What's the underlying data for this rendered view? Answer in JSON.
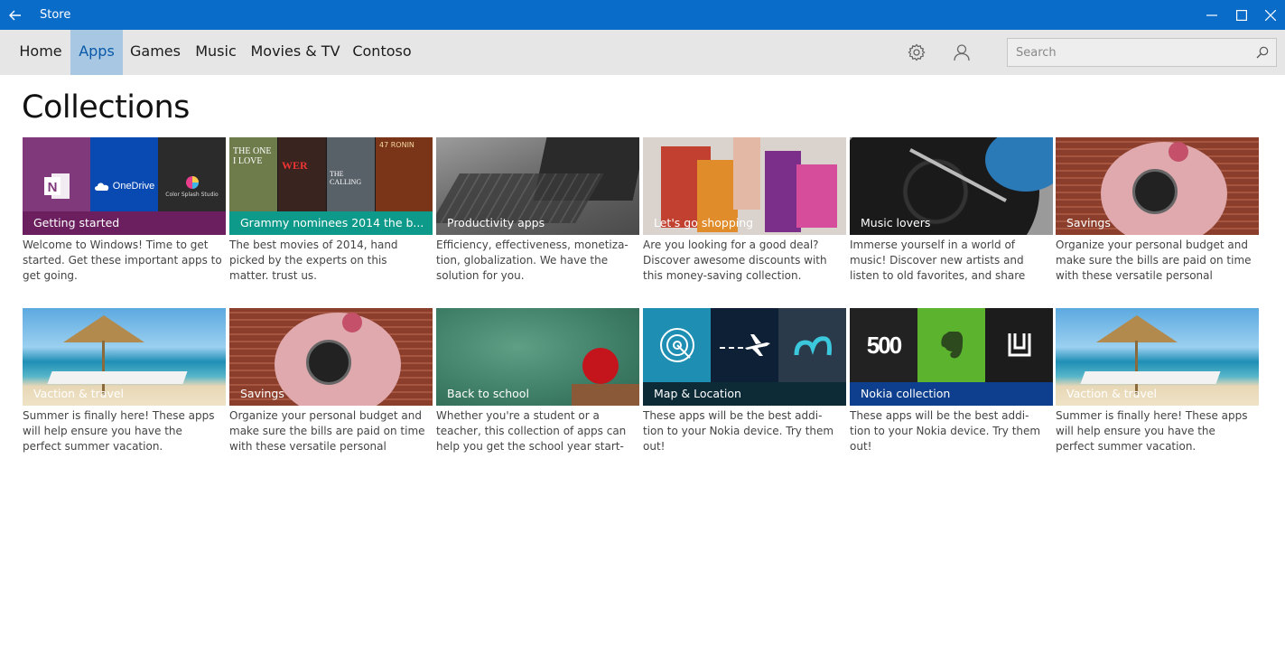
{
  "window": {
    "title": "Store",
    "accent": "#0a6cc9"
  },
  "nav": {
    "items": [
      {
        "label": "Home"
      },
      {
        "label": "Apps",
        "active": true
      },
      {
        "label": "Games"
      },
      {
        "label": "Music"
      },
      {
        "label": "Movies & TV"
      },
      {
        "label": "Contoso"
      }
    ],
    "icons": [
      "settings-icon",
      "account-icon"
    ],
    "search_placeholder": "Search"
  },
  "page": {
    "heading": "Collections"
  },
  "cards": [
    {
      "caption": "Getting started",
      "desc": "Welcome to Windows! Time to get started. Get these important apps to get going.",
      "tiles": [
        "OneNote",
        "OneDrive",
        "Color Splash Studio"
      ]
    },
    {
      "caption": "Grammy nominees 2014 the b...",
      "desc": "The best movies of 2014, hand picked by the experts on this matter. trust us.",
      "posters": [
        "THE ONE I LOVE",
        "WER",
        "THE CALLING",
        "47 RONIN"
      ]
    },
    {
      "caption": "Productivity apps",
      "desc": "Efficiency, effectiveness, monetiza- tion, globalization. We have the solution for you."
    },
    {
      "caption": "Let's go shopping",
      "desc": "Are you looking for a good deal? Discover awesome discounts with this money-saving collection."
    },
    {
      "caption": "Music lovers",
      "desc": "Immerse yourself in a world of music! Discover new artists and listen to old favorites, and share"
    },
    {
      "caption": "Savings",
      "desc": "Organize your personal budget and make sure the bills are paid on time with these versatile personal"
    },
    {
      "caption": "Vaction & travel",
      "desc": "Summer is finally here! These apps will help ensure you have the perfect summer vacation."
    },
    {
      "caption": "Savings",
      "desc": "Organize your personal budget and make sure the bills are paid on time with these versatile personal"
    },
    {
      "caption": "Back to school",
      "desc": "Whether you're a student or a teacher, this collection of apps can help you get the school year start-"
    },
    {
      "caption": "Map & Location",
      "desc": "These apps will be the best addi- tion to your Nokia device. Try them out!"
    },
    {
      "caption": "Nokia collection",
      "desc": "These apps will be the best addi- tion to your Nokia device. Try them out!",
      "tiles": [
        "500"
      ]
    },
    {
      "caption": "Vaction & travel",
      "desc": "Summer is finally here! These apps will help ensure you have the perfect summer vacation."
    }
  ]
}
